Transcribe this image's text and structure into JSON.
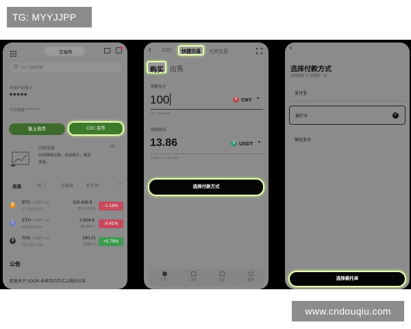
{
  "watermarks": {
    "tg": "TG: MYYJJPP",
    "site": "www.cndouqiu.com"
  },
  "phone1": {
    "exchange_label": "交易所",
    "search_placeholder": "SUI 当前热搜",
    "assets_label": "总资产估值 ¥",
    "assets_value": "*****",
    "pnl_label": "今日收益 **********",
    "btn_onchain": "链上充币",
    "btn_c2c": "C2C 买币",
    "flash_title": "闪兑交易",
    "flash_page": "1/3",
    "flash_desc_1": "支持跨链兑换，自动换汇，确定",
    "flash_desc_2": "收益。",
    "tabs": [
      "自选",
      "热门",
      "涨幅榜",
      "新币榜"
    ],
    "coins": [
      {
        "symbol": "BTC",
        "pair": "/ USDT",
        "lev": "10x",
        "vol": "7.77万亿 BTC",
        "price": "110,436.8",
        "cny": "$110,436.8",
        "change": "-1.13%",
        "icon": "bitcoin-icon",
        "color": "#e08a1e",
        "chg_color": "#c64a5e"
      },
      {
        "symbol": "ETH",
        "pair": "/ USDT",
        "lev": "10x",
        "vol": "30.92万 ETH",
        "price": "2,654.4",
        "cny": "$2,654.4",
        "change": "-0.41%",
        "icon": "ethereum-icon",
        "color": "#6d7cc8",
        "chg_color": "#c64a5e"
      },
      {
        "symbol": "SOL",
        "pair": "/ USDT",
        "lev": "10x",
        "vol": "105.21万 SOL",
        "price": "180.21",
        "cny": "$180.21",
        "change": "+0.79%",
        "icon": "solana-icon",
        "color": "#2b2b2b",
        "chg_color": "#3f9a4f"
      }
    ],
    "announce_title": "公告",
    "announce_text": "欧易关于 SOON 永续合约正式上线的公告"
  },
  "phone2": {
    "tab_c2c": "C2C",
    "tab_quick": "快捷交易",
    "tab_block": "大宗交易",
    "buy": "购买",
    "sell": "出售",
    "pay_label": "我要支付",
    "pay_value": "100",
    "pay_currency": "CNY",
    "pay_limit": "10 - 7,000,000",
    "receive_label": "我将收到",
    "receive_value": "13.86",
    "receive_currency": "USDT",
    "rate": "1 USDT ≈ 7.21 CNY",
    "select_method_btn": "选择付款方式",
    "nav": [
      "C2C",
      "订单",
      "消息",
      "我的"
    ]
  },
  "phone3": {
    "title": "选择付款方式",
    "subtitle": "此刻费率 27 秒更新一次",
    "options": [
      "支付宝",
      "银行卡",
      "微信支付"
    ],
    "selected_index": 1,
    "confirm_btn": "选择委托单"
  }
}
